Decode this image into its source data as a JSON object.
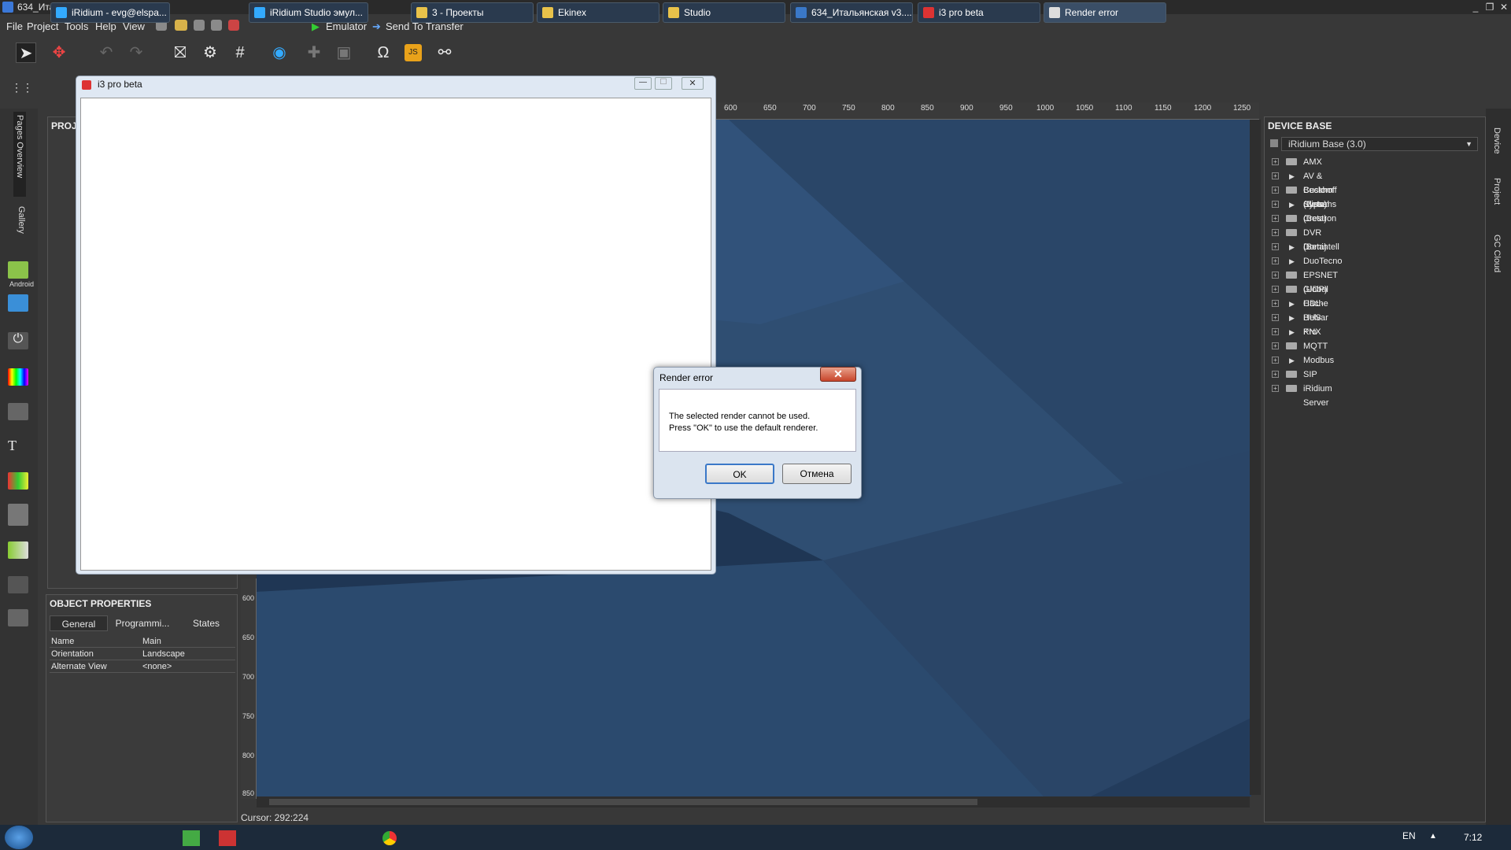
{
  "window": {
    "title": "634_Итальянская v3.irpz",
    "controls": [
      "_",
      "❐",
      "✕"
    ]
  },
  "menu": [
    "File",
    "Project",
    "Tools",
    "Help",
    "View"
  ],
  "toolbar": {
    "emulator": "Emulator",
    "send": "Send To Transfer"
  },
  "sidebar": {
    "pages_overview": "Pages Overview",
    "gallery": "Gallery",
    "android": "Android"
  },
  "project_panel": {
    "title": "PROJE"
  },
  "object_properties": {
    "title": "OBJECT PROPERTIES",
    "tabs": [
      "General",
      "Programmi...",
      "States"
    ],
    "rows": [
      {
        "key": "Name",
        "value": "Main"
      },
      {
        "key": "Orientation",
        "value": "Landscape"
      },
      {
        "key": "Alternate View",
        "value": "<none>"
      }
    ]
  },
  "ruler_top": [
    "600",
    "650",
    "700",
    "750",
    "800",
    "850",
    "900",
    "950",
    "1000",
    "1050",
    "1100",
    "1150",
    "1200",
    "1250"
  ],
  "ruler_left": [
    "600",
    "650",
    "700",
    "750",
    "800",
    "850"
  ],
  "status": {
    "cursor": "Cursor: 292:224"
  },
  "device_base": {
    "title": "DEVICE BASE",
    "selected": "iRidium Base (3.0)",
    "items": [
      {
        "label": "AMX",
        "kind": "device"
      },
      {
        "label": "AV & Custom Systems",
        "kind": "folder"
      },
      {
        "label": "Beckhoff (Beta)",
        "kind": "device"
      },
      {
        "label": "Clipsal (Beta)",
        "kind": "folder"
      },
      {
        "label": "Crestron",
        "kind": "device"
      },
      {
        "label": "DVR (Beta)",
        "kind": "device"
      },
      {
        "label": "Domintell",
        "kind": "folder"
      },
      {
        "label": "DuoTecno",
        "kind": "folder"
      },
      {
        "label": "EPSNET (UDP)",
        "kind": "device"
      },
      {
        "label": "Global Cache",
        "kind": "device"
      },
      {
        "label": "HDL-BUS Pro",
        "kind": "folder"
      },
      {
        "label": "Helvar",
        "kind": "folder"
      },
      {
        "label": "KNX",
        "kind": "folder"
      },
      {
        "label": "MQTT",
        "kind": "device"
      },
      {
        "label": "Modbus",
        "kind": "folder"
      },
      {
        "label": "SIP",
        "kind": "device"
      },
      {
        "label": "iRidium Server",
        "kind": "device"
      }
    ]
  },
  "right_tabs": [
    "Device",
    "Project",
    "GC Cloud"
  ],
  "i3_window": {
    "title": "i3 pro beta"
  },
  "dialog": {
    "title": "Render error",
    "line1": "The selected render cannot be used.",
    "line2": "Press \"OK\" to use the default renderer.",
    "ok": "OK",
    "cancel": "Отмена"
  },
  "taskbar": {
    "items": [
      "iRidium - evg@elspa...",
      "iRidium Studio эмул...",
      "3 - Проекты",
      "Ekinex",
      "Studio",
      "634_Итальянская v3....",
      "i3 pro beta",
      "Render error"
    ],
    "lang": "EN",
    "time": "7:12"
  }
}
